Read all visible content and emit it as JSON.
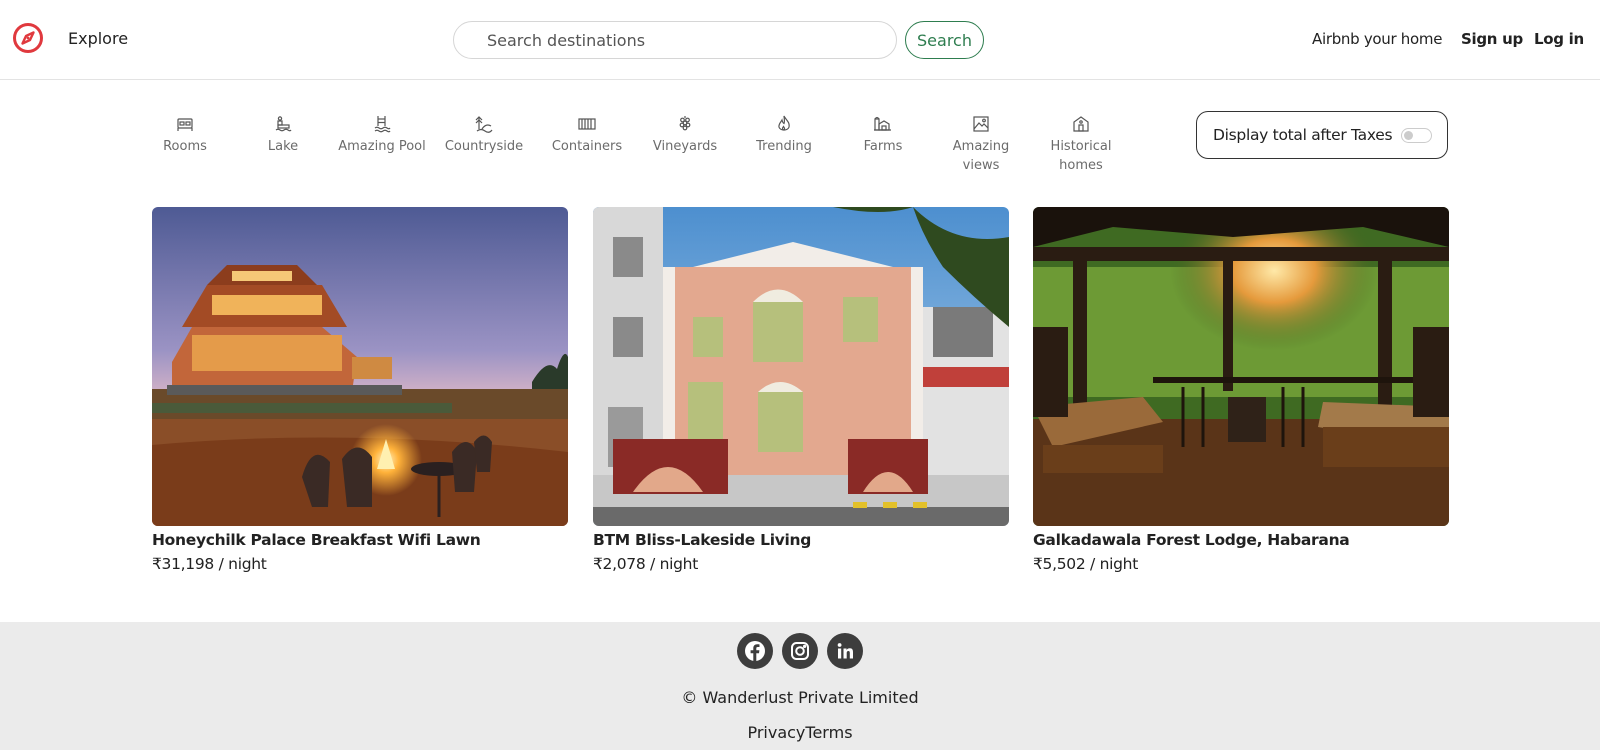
{
  "navbar": {
    "logo_icon": "compass-icon",
    "brand_color": "#e0393e",
    "explore_label": "Explore",
    "search_placeholder": "Search destinations",
    "search_button_label": "Search",
    "search_button_color": "#2e7d4f",
    "host_label": "Airbnb your home",
    "signup_label": "Sign up",
    "login_label": "Log in"
  },
  "filters": [
    {
      "label": "Rooms",
      "icon": "bed-icon"
    },
    {
      "label": "Lake",
      "icon": "lake-icon"
    },
    {
      "label": "Amazing Pool",
      "icon": "pool-icon"
    },
    {
      "label": "Countryside",
      "icon": "countryside-icon"
    },
    {
      "label": "Containers",
      "icon": "container-icon"
    },
    {
      "label": "Vineyards",
      "icon": "grapes-icon"
    },
    {
      "label": "Trending",
      "icon": "fire-icon"
    },
    {
      "label": "Farms",
      "icon": "farm-icon"
    },
    {
      "label": "Amazing views",
      "icon": "mountain-view-icon"
    },
    {
      "label": "Historical homes",
      "icon": "historic-home-icon"
    }
  ],
  "tax_toggle": {
    "label": "Display total after Taxes",
    "enabled": false
  },
  "listings": [
    {
      "title": "Honeychilk Palace Breakfast Wifi Lawn",
      "price": "₹31,198 / night"
    },
    {
      "title": "BTM Bliss-Lakeside Living",
      "price": "₹2,078 / night"
    },
    {
      "title": "Galkadawala Forest Lodge, Habarana",
      "price": "₹5,502 / night"
    }
  ],
  "footer": {
    "social": [
      "facebook-icon",
      "instagram-icon",
      "linkedin-icon"
    ],
    "copyright": "© Wanderlust Private Limited",
    "privacy_label": "Privacy",
    "terms_label": "Terms"
  }
}
